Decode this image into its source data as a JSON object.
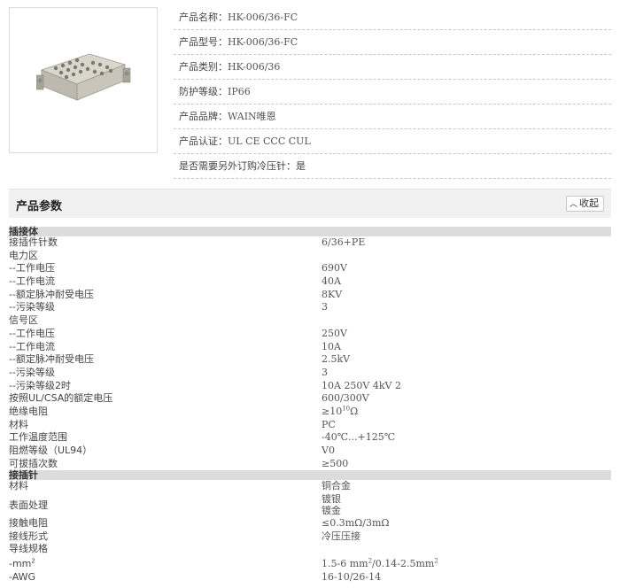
{
  "product": {
    "info": [
      {
        "label": "产品名称：",
        "value": "HK-006/36-FC"
      },
      {
        "label": "产品型号：",
        "value": "HK-006/36-FC"
      },
      {
        "label": "产品类别：",
        "value": "HK-006/36"
      },
      {
        "label": "防护等级：",
        "value": "IP66"
      },
      {
        "label": "产品品牌：",
        "value": "WAIN唯恩"
      },
      {
        "label": "产品认证：",
        "value": "UL CE CCC CUL"
      },
      {
        "label": "是否需要另外订购冷压针：",
        "value": "是"
      }
    ]
  },
  "params": {
    "title": "产品参数",
    "collapse_label": "收起",
    "section1": "插接体",
    "rows1": [
      {
        "k": "接插件针数",
        "v": "6/36+PE"
      },
      {
        "k": "电力区",
        "v": ""
      },
      {
        "k": "--工作电压",
        "v": "690V"
      },
      {
        "k": "--工作电流",
        "v": "40A"
      },
      {
        "k": "--额定脉冲耐受电压",
        "v": "8KV"
      },
      {
        "k": "--污染等级",
        "v": "3"
      },
      {
        "k": "信号区",
        "v": ""
      },
      {
        "k": "--工作电压",
        "v": "250V"
      },
      {
        "k": "--工作电流",
        "v": "10A"
      },
      {
        "k": "--额定脉冲耐受电压",
        "v": "2.5kV"
      },
      {
        "k": "--污染等级",
        "v": "3"
      },
      {
        "k": "--污染等级2时",
        "v": "10A 250V 4kV 2"
      },
      {
        "k": "按照UL/CSA的额定电压",
        "v": "600/300V"
      },
      {
        "k": "绝缘电阻",
        "v_pre": "≥10",
        "v_sup": "10",
        "v_post": "Ω"
      },
      {
        "k": "材料",
        "v": "PC"
      },
      {
        "k": "工作温度范围",
        "v": "-40℃...+125℃"
      },
      {
        "k": "阻燃等级（UL94）",
        "v": "V0"
      },
      {
        "k": "可拔插次数",
        "v": "≥500"
      }
    ],
    "section2": "接插针",
    "material": {
      "k": "材料",
      "v": "铜合金"
    },
    "surface": {
      "k": "表面处理",
      "v1": "镀银",
      "v2": "镀金"
    },
    "rows2": [
      {
        "k": "接触电阻",
        "v": "≤0.3mΩ/3mΩ"
      },
      {
        "k": "接线形式",
        "v": "冷压压接"
      },
      {
        "k": "导线规格",
        "v": ""
      }
    ],
    "mm2": {
      "k": "-mm",
      "k_sup": "2",
      "v_a": "1.5-6 mm",
      "v_sup1": "2",
      "v_b": "/0.14-2.5mm",
      "v_sup2": "2"
    },
    "awg": {
      "k": "-AWG",
      "v": "16-10/26-14"
    }
  }
}
